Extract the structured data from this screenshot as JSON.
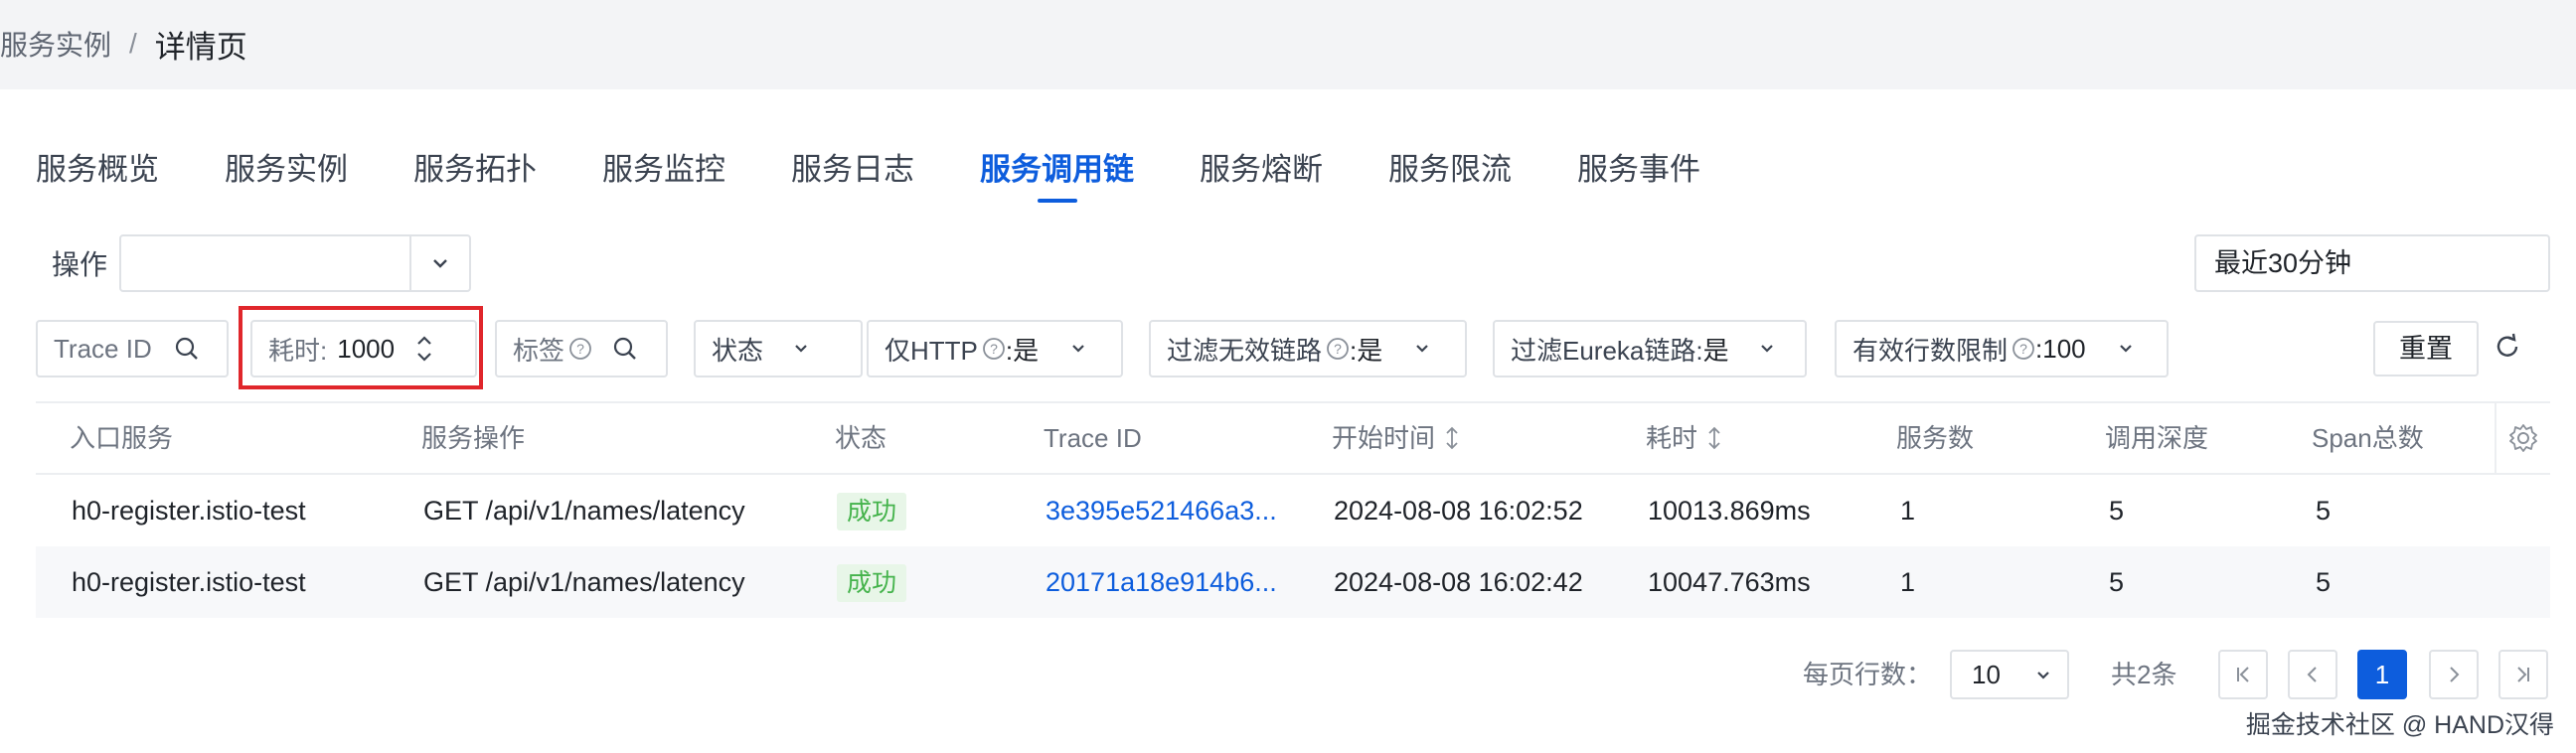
{
  "breadcrumb": {
    "parent": "服务实例",
    "separator": "/",
    "current": "详情页"
  },
  "tabs": [
    {
      "label": "服务概览"
    },
    {
      "label": "服务实例"
    },
    {
      "label": "服务拓扑"
    },
    {
      "label": "服务监控"
    },
    {
      "label": "服务日志"
    },
    {
      "label": "服务调用链",
      "active": true
    },
    {
      "label": "服务熔断"
    },
    {
      "label": "服务限流"
    },
    {
      "label": "服务事件"
    }
  ],
  "operation": {
    "label": "操作",
    "value": ""
  },
  "time_range": {
    "value": "最近30分钟"
  },
  "filters": {
    "trace_id_placeholder": "Trace ID",
    "duration_label": "耗时:",
    "duration_value": "1000",
    "tag_placeholder": "标签",
    "status_label": "状态",
    "http_only_label": "仅HTTP",
    "http_only_value": ":是",
    "filter_invalid_label": "过滤无效链路",
    "filter_invalid_value": ":是",
    "filter_eureka_label": "过滤Eureka链路:",
    "filter_eureka_value": "是",
    "row_limit_label": "有效行数限制",
    "row_limit_value": ":100",
    "reset_label": "重置"
  },
  "table": {
    "columns": [
      "入口服务",
      "服务操作",
      "状态",
      "Trace ID",
      "开始时间",
      "耗时",
      "服务数",
      "调用深度",
      "Span总数"
    ],
    "rows": [
      {
        "entry_service": "h0-register.istio-test",
        "operation": "GET /api/v1/names/latency",
        "status": "成功",
        "trace_id": "3e395e521466a3...",
        "start_time": "2024-08-08 16:02:52",
        "duration": "10013.869ms",
        "services": "1",
        "depth": "5",
        "spans": "5"
      },
      {
        "entry_service": "h0-register.istio-test",
        "operation": "GET /api/v1/names/latency",
        "status": "成功",
        "trace_id": "20171a18e914b6...",
        "start_time": "2024-08-08 16:02:42",
        "duration": "10047.763ms",
        "services": "1",
        "depth": "5",
        "spans": "5"
      }
    ]
  },
  "pagination": {
    "rows_per_page_label": "每页行数：",
    "rows_per_page": "10",
    "total": "共2条",
    "current_page": "1"
  },
  "watermark": "掘金技术社区 @ HAND汉得",
  "colors": {
    "accent": "#0d5ddd",
    "success_text": "#45b34c",
    "highlight_border": "#e0262b"
  }
}
